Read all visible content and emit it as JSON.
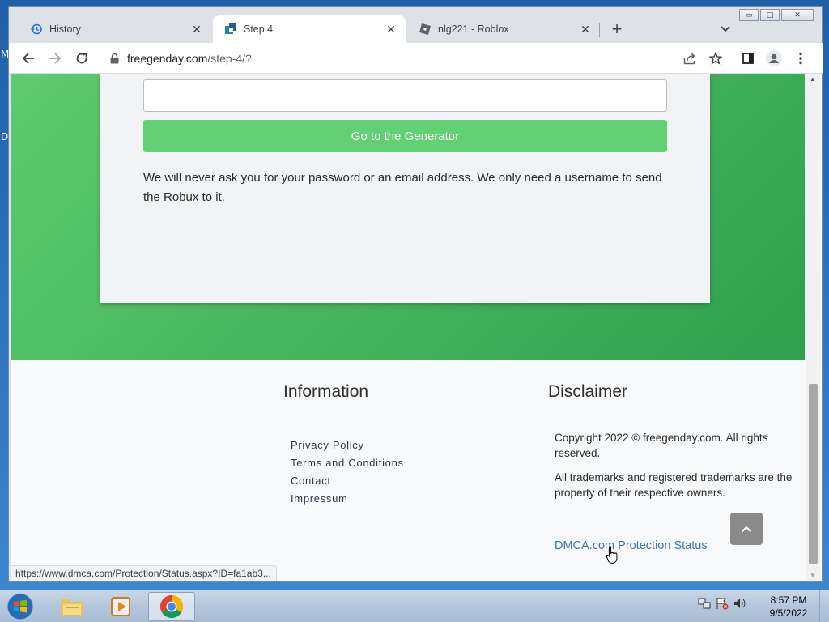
{
  "desktop": {
    "edge_letters": [
      "M",
      "D"
    ]
  },
  "window": {
    "controls": {
      "minimize": "▭",
      "maximize": "□",
      "close": "✕"
    }
  },
  "tabs": [
    {
      "title": "History",
      "icon": "history-icon",
      "active": false
    },
    {
      "title": "Step 4",
      "icon": "site-favicon",
      "active": true
    },
    {
      "title": "nlg221 - Roblox",
      "icon": "roblox-icon",
      "active": false
    }
  ],
  "toolbar": {
    "url_host": "freegenday.com",
    "url_path": "/step-4/?"
  },
  "card": {
    "username_value": "",
    "generator_button": "Go to the Generator",
    "note": "We will never ask you for your password or an email address. We only need a username to send the Robux to it."
  },
  "footer": {
    "info_heading": "Information",
    "links": [
      "Privacy Policy",
      "Terms and Conditions",
      "Contact",
      "Impressum"
    ],
    "disclaimer_heading": "Disclaimer",
    "copyright": "Copyright 2022 © freegenday.com. All rights reserved.",
    "trademarks": "All trademarks and registered trademarks are the property of their respective owners.",
    "dmca_alt": "DMCA.com Protection Status"
  },
  "status_url": "https://www.dmca.com/Protection/Status.aspx?ID=fa1ab3...",
  "taskbar": {
    "time": "8:57 PM",
    "date": "9/5/2022"
  },
  "colors": {
    "hero_green": "#5ecb6e",
    "button_green": "#62d073",
    "link_blue": "#3c73a8"
  }
}
